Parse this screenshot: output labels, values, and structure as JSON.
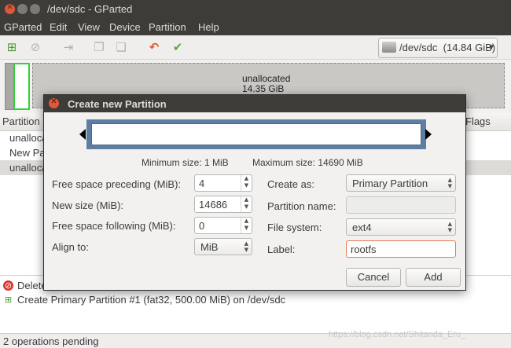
{
  "window": {
    "title": "/dev/sdc - GParted"
  },
  "menubar": [
    "GParted",
    "Edit",
    "View",
    "Device",
    "Partition",
    "Help"
  ],
  "toolbar": {
    "device": "/dev/sdc",
    "device_size": "(14.84 GiB)"
  },
  "disk_graph": {
    "unallocated_label": "unallocated",
    "unallocated_size": "14.35 GiB"
  },
  "partition_list": {
    "headers": {
      "partition": "Partition",
      "flags": "Flags"
    },
    "rows": [
      "unalloca",
      "New Pa",
      "unalloca"
    ]
  },
  "operations": {
    "items": [
      {
        "text": "Delete",
        "icon": "delete-icon"
      },
      {
        "text": "Create Primary Partition #1 (fat32, 500.00 MiB) on /dev/sdc",
        "icon": "create-partition-icon"
      }
    ],
    "status": "2 operations pending"
  },
  "watermark": "https://blog.csdn.net/Shitanda_Eru_",
  "dialog": {
    "title": "Create new Partition",
    "min_size": "Minimum size: 1 MiB",
    "max_size": "Maximum size: 14690 MiB",
    "fields": {
      "free_preceding": {
        "label": "Free space preceding (MiB):",
        "value": "4"
      },
      "new_size": {
        "label": "New size (MiB):",
        "value": "14686"
      },
      "free_following": {
        "label": "Free space following (MiB):",
        "value": "0"
      },
      "align_to": {
        "label": "Align to:",
        "value": "MiB"
      },
      "create_as": {
        "label": "Create as:",
        "value": "Primary Partition"
      },
      "partition_name": {
        "label": "Partition name:",
        "value": ""
      },
      "file_system": {
        "label": "File system:",
        "value": "ext4"
      },
      "label": {
        "label": "Label:",
        "value": "rootfs"
      }
    },
    "buttons": {
      "cancel": "Cancel",
      "add": "Add"
    }
  },
  "colors": {
    "title_bar": "#3d3c38",
    "close_button": "#e0573b",
    "partition_fat32": "#31d039",
    "resizer": "#5e7fa3",
    "focus_border": "#e77b53"
  }
}
